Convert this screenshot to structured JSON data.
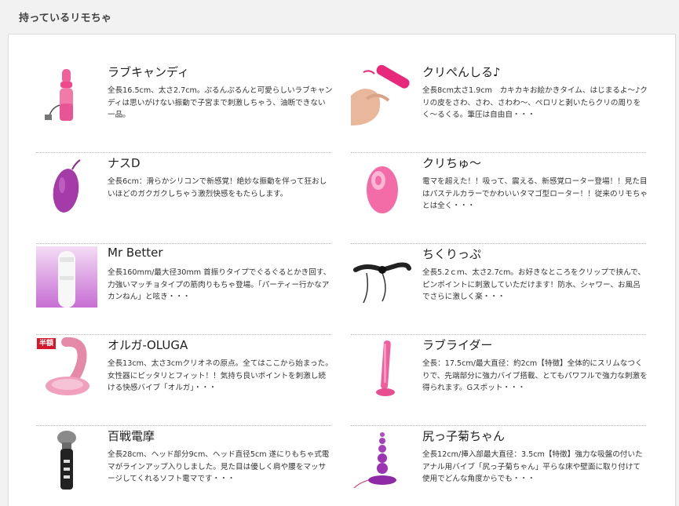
{
  "page": {
    "section_title": "持っているリモちゃ"
  },
  "items": [
    {
      "title": "ラブキャンディ",
      "description": "全長16.5cm、太さ2.7cm。ぷるんぷるんと可愛らしいラブキャンディは思いがけない振動で子宮まで刺激しちゃう、油断できない一品。",
      "icon": "pink-vibrator-image"
    },
    {
      "title": "クリぺんしる♪",
      "description": "全長8cm太さ1.9cm　カキカキお絵かきタイム、はじまるよ～♪クリの皮をさわ、さわ、さわわ～、ペロリと剥いたらクリの周りをく～るくる。筆圧は自由自・・・",
      "icon": "pink-pencil-toy-image"
    },
    {
      "title": "ナスD",
      "description": "全長6cm：滑らかシリコンで新感覚！絶妙な振動を伴って狂おしいほどのガクガクしちゃう激烈快感をもたらします。",
      "icon": "purple-egg-image"
    },
    {
      "title": "クリちゅ～",
      "description": "電マを超えた！！吸って、震える、新感覚ローター登場！！見た目はパステルカラーでかわいいタマゴ型ローター！！従来のリモちゃとは全く・・・",
      "icon": "pink-egg-rotor-image"
    },
    {
      "title": "Mr Better",
      "description": "全長160mm/最大径30mm 首振りタイプでぐるぐるとかき回す、力強いマッチョタイプの筋肉りもちゃ登場。「パーティー行かなアカンねん」と呟き・・・",
      "icon": "white-toy-image"
    },
    {
      "title": "ちくりっぷ",
      "description": "全長5.2ｃｍ、太さ2.7cm。お好きなところをクリップで挟んで、ピンポイントに刺激していただけます！防水、シャワー、お風呂でさらに激しく楽・・・",
      "icon": "black-clip-image"
    },
    {
      "title": "オルガ-OLUGA",
      "description": "全長13cm、太さ3cmクリオネの原点。全てはここから始まった。女性器にピッタリとフィット！！気持ち良いポイントを刺激し続ける快感バイブ「オルガ」・・・",
      "icon": "pink-oluga-image",
      "badge": "半額"
    },
    {
      "title": "ラブライダー",
      "description": "全長：17.5cm/最大直径：約2cm【特徴】全体的にスリムなつくりで、先端部分に強力バイブ搭載、とてもパワフルで強力な刺激を得られます。Gスポット・・・",
      "icon": "pink-slim-vibe-image"
    },
    {
      "title": "百戦電摩",
      "description": "全長28cm、ヘッド部分9cm、ヘッド直径5cm 遂にりもちゃ式電マがラインアップ入りしました。見た目は優しく肩や腰をマッサージしてくれるソフト電マです・・・",
      "icon": "wand-massager-image"
    },
    {
      "title": "尻っ子菊ちゃん",
      "description": "全長12cm/挿入部最大直径：3.5cm【特徴】強力な吸盤の付いたアナル用バイブ「尻っ子菊ちゃん」平らな床や壁面に取り付けて使用でどんな角度からでも・・・",
      "icon": "purple-beads-image"
    }
  ],
  "colors": {
    "background": "#f2f2f2",
    "panel": "#ffffff",
    "badge": "#d7182a"
  }
}
